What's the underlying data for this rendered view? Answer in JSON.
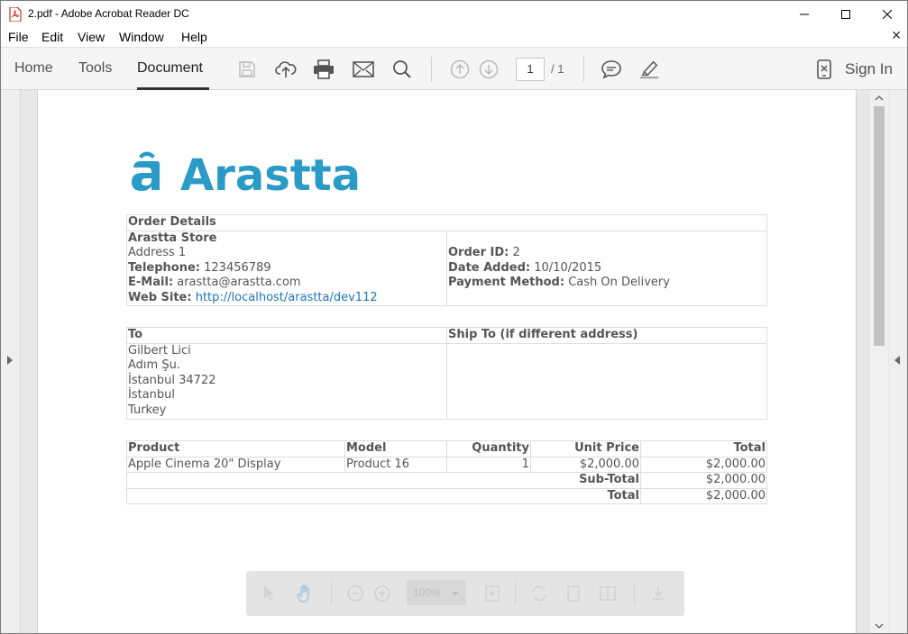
{
  "window": {
    "title": "2.pdf - Adobe Acrobat Reader DC"
  },
  "menu": [
    "File",
    "Edit",
    "View",
    "Window",
    "Help"
  ],
  "toolbar": {
    "tabs": [
      "Home",
      "Tools",
      "Document"
    ],
    "active_tab": "Document",
    "page_current": "1",
    "page_total": "/ 1",
    "sign_in": "Sign In"
  },
  "floatbar": {
    "zoom": "100%"
  },
  "icons": {
    "save": "save-icon",
    "upload": "upload-cloud-icon",
    "print": "print-icon",
    "email": "mail-icon",
    "search": "search-icon",
    "prev_page": "arrow-up-icon",
    "next_page": "arrow-down-icon",
    "comment": "comment-icon",
    "highlight": "highlighter-icon",
    "mobile": "mobile-icon"
  },
  "brand": {
    "name": "Arastta",
    "color": "#2a9bc6"
  },
  "invoice": {
    "order_details_heading": "Order Details",
    "store": {
      "name": "Arastta Store",
      "address": "Address 1",
      "telephone_label": "Telephone:",
      "telephone": "123456789",
      "email_label": "E-Mail:",
      "email": "arastta@arastta.com",
      "website_label": "Web Site:",
      "website": "http://localhost/arastta/dev112"
    },
    "order": {
      "id_label": "Order ID:",
      "id": "2",
      "date_label": "Date Added:",
      "date": "10/10/2015",
      "payment_label": "Payment Method:",
      "payment": "Cash On Delivery"
    },
    "to_heading": "To",
    "ship_to_heading": "Ship To (if different address)",
    "to_lines": [
      "Gilbert Lici",
      "Adım Şu.",
      "İstanbul 34722",
      "İstanbul",
      "Turkey"
    ],
    "products_headers": [
      "Product",
      "Model",
      "Quantity",
      "Unit Price",
      "Total"
    ],
    "products": [
      {
        "product": "Apple Cinema 20\" Display",
        "model": "Product 16",
        "quantity": "1",
        "unit_price": "$2,000.00",
        "total": "$2,000.00"
      }
    ],
    "subtotal_label": "Sub-Total",
    "subtotal": "$2,000.00",
    "total_label": "Total",
    "total": "$2,000.00"
  }
}
